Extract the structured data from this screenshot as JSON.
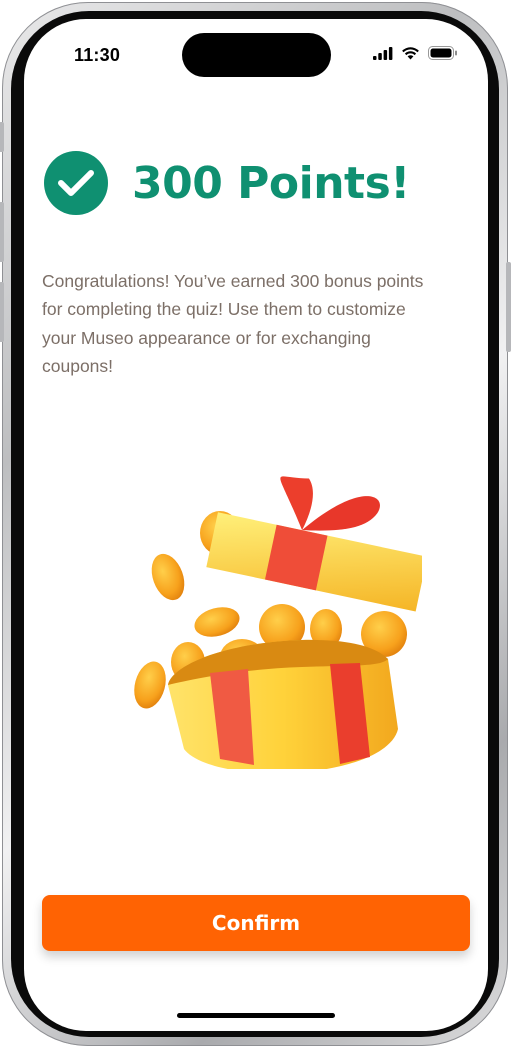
{
  "status_bar": {
    "time": "11:30"
  },
  "reward": {
    "title": "300 Points!",
    "message": "Congratulations! You’ve earned 300 bonus points for completing the quiz! Use them to customize your Museo appearance  or for exchanging coupons!"
  },
  "illustration": {
    "icon": "gift-box-coins-icon"
  },
  "actions": {
    "confirm_label": "Confirm"
  },
  "colors": {
    "accent_green": "#0f9071",
    "button_orange": "#ff6303",
    "body_text": "#7c6f67"
  }
}
